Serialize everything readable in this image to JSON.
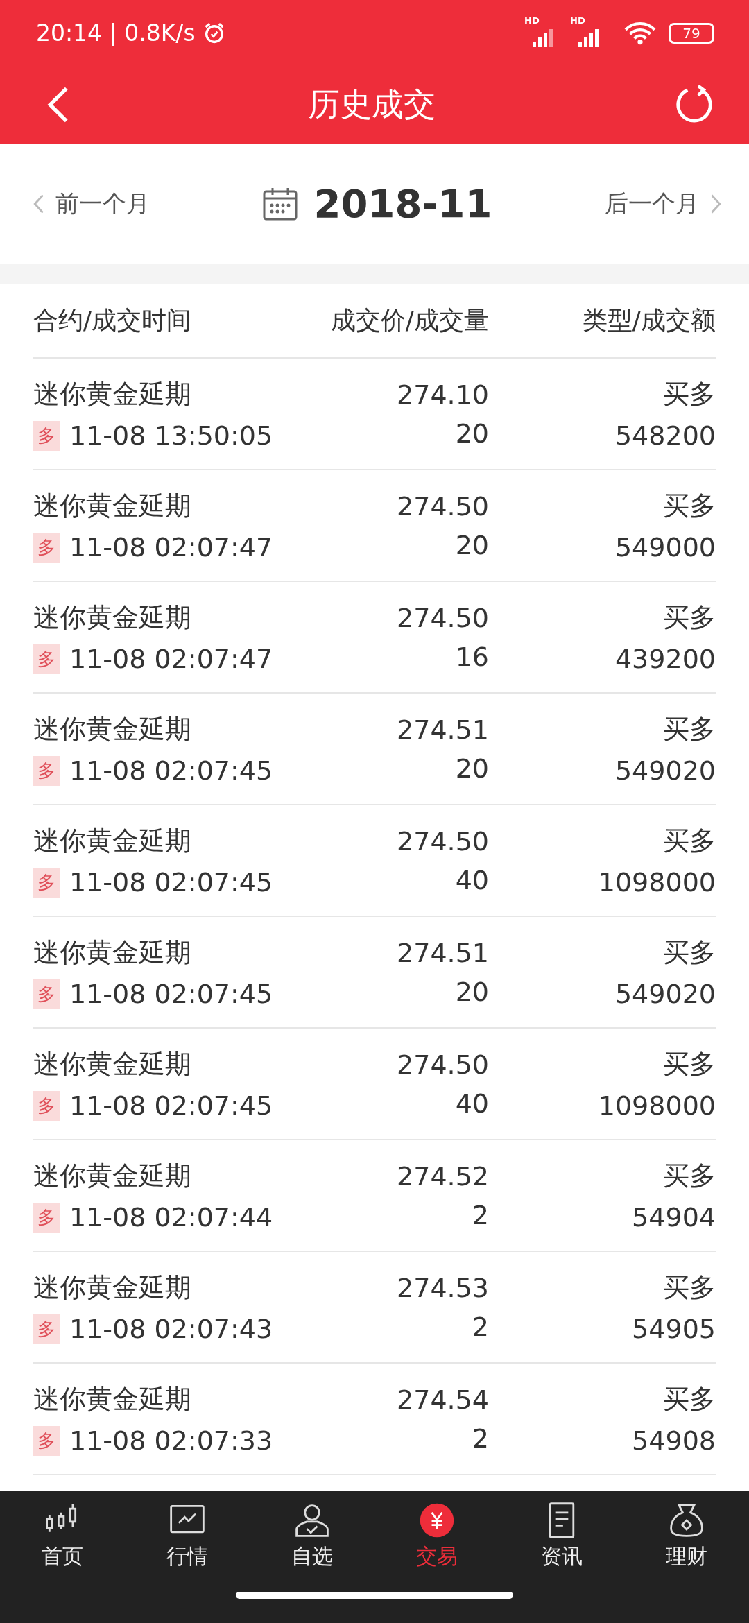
{
  "status_bar": {
    "time": "20:14 | 0.8K/s",
    "signals": [
      "HD",
      "HD"
    ],
    "battery": "79"
  },
  "header": {
    "title": "历史成交"
  },
  "month_bar": {
    "prev": "前一个月",
    "month": "2018-11",
    "next": "后一个月"
  },
  "columns": [
    "合约/成交时间",
    "成交价/成交量",
    "类型/成交额"
  ],
  "rows": [
    {
      "name": "迷你黄金延期",
      "tag": "多",
      "time": "11-08 13:50:05",
      "price": "274.10",
      "volume": "20",
      "type": "买多",
      "amount": "548200"
    },
    {
      "name": "迷你黄金延期",
      "tag": "多",
      "time": "11-08 02:07:47",
      "price": "274.50",
      "volume": "20",
      "type": "买多",
      "amount": "549000"
    },
    {
      "name": "迷你黄金延期",
      "tag": "多",
      "time": "11-08 02:07:47",
      "price": "274.50",
      "volume": "16",
      "type": "买多",
      "amount": "439200"
    },
    {
      "name": "迷你黄金延期",
      "tag": "多",
      "time": "11-08 02:07:45",
      "price": "274.51",
      "volume": "20",
      "type": "买多",
      "amount": "549020"
    },
    {
      "name": "迷你黄金延期",
      "tag": "多",
      "time": "11-08 02:07:45",
      "price": "274.50",
      "volume": "40",
      "type": "买多",
      "amount": "1098000"
    },
    {
      "name": "迷你黄金延期",
      "tag": "多",
      "time": "11-08 02:07:45",
      "price": "274.51",
      "volume": "20",
      "type": "买多",
      "amount": "549020"
    },
    {
      "name": "迷你黄金延期",
      "tag": "多",
      "time": "11-08 02:07:45",
      "price": "274.50",
      "volume": "40",
      "type": "买多",
      "amount": "1098000"
    },
    {
      "name": "迷你黄金延期",
      "tag": "多",
      "time": "11-08 02:07:44",
      "price": "274.52",
      "volume": "2",
      "type": "买多",
      "amount": "54904"
    },
    {
      "name": "迷你黄金延期",
      "tag": "多",
      "time": "11-08 02:07:43",
      "price": "274.53",
      "volume": "2",
      "type": "买多",
      "amount": "54905"
    },
    {
      "name": "迷你黄金延期",
      "tag": "多",
      "time": "11-08 02:07:33",
      "price": "274.54",
      "volume": "2",
      "type": "买多",
      "amount": "54908"
    }
  ],
  "bottom_nav": [
    {
      "label": "首页",
      "selected": false
    },
    {
      "label": "行情",
      "selected": false
    },
    {
      "label": "自选",
      "selected": false
    },
    {
      "label": "交易",
      "selected": true
    },
    {
      "label": "资讯",
      "selected": false
    },
    {
      "label": "理财",
      "selected": false
    }
  ]
}
